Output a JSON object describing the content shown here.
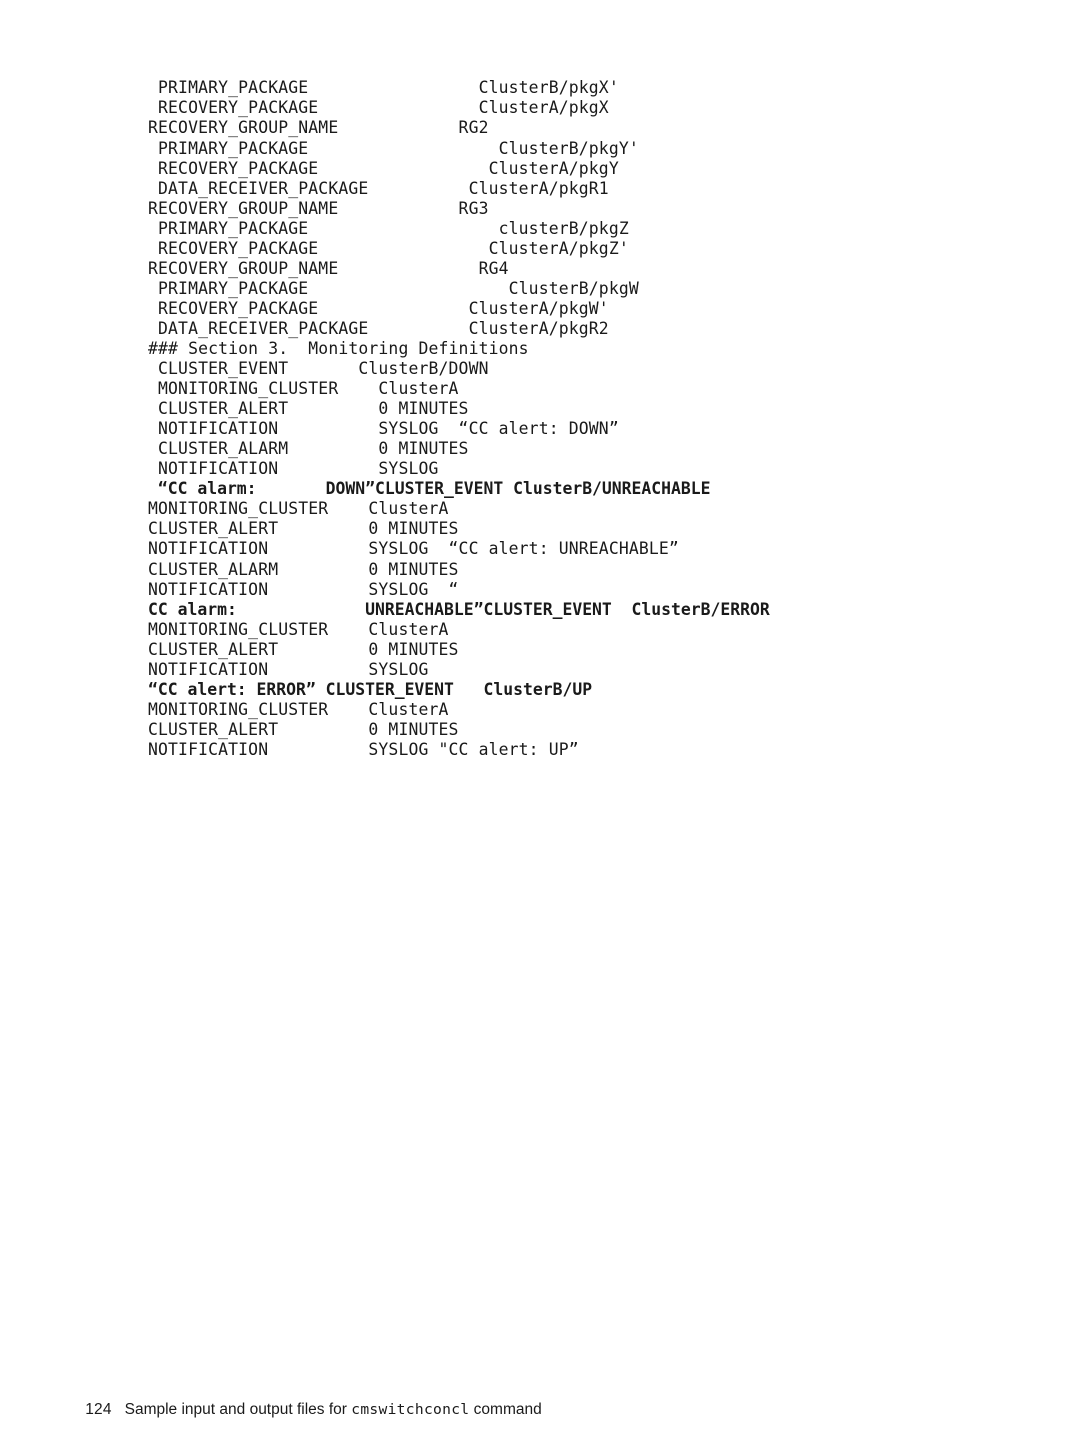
{
  "document": {
    "page_number": "124",
    "footer_caption_before": "Sample input and output files for ",
    "footer_command": "cmswitchconcl",
    "footer_caption_after": " command"
  },
  "code_listing": {
    "lines": [
      {
        "text": " PRIMARY_PACKAGE                 ClusterB/pkgX'",
        "emphasis": false
      },
      {
        "text": " RECOVERY_PACKAGE                ClusterA/pkgX",
        "emphasis": false
      },
      {
        "text": "RECOVERY_GROUP_NAME            RG2",
        "emphasis": false
      },
      {
        "text": " PRIMARY_PACKAGE                   ClusterB/pkgY'",
        "emphasis": false
      },
      {
        "text": " RECOVERY_PACKAGE                 ClusterA/pkgY",
        "emphasis": false
      },
      {
        "text": " DATA_RECEIVER_PACKAGE          ClusterA/pkgR1",
        "emphasis": false
      },
      {
        "text": "RECOVERY_GROUP_NAME            RG3",
        "emphasis": false
      },
      {
        "text": " PRIMARY_PACKAGE                   clusterB/pkgZ",
        "emphasis": false
      },
      {
        "text": " RECOVERY_PACKAGE                 ClusterA/pkgZ'",
        "emphasis": false
      },
      {
        "text": "RECOVERY_GROUP_NAME              RG4",
        "emphasis": false
      },
      {
        "text": " PRIMARY_PACKAGE                    ClusterB/pkgW",
        "emphasis": false
      },
      {
        "text": " RECOVERY_PACKAGE               ClusterA/pkgW'",
        "emphasis": false
      },
      {
        "text": " DATA_RECEIVER_PACKAGE          ClusterA/pkgR2",
        "emphasis": false
      },
      {
        "text": "### Section 3.  Monitoring Definitions",
        "emphasis": false
      },
      {
        "text": " CLUSTER_EVENT       ClusterB/DOWN",
        "emphasis": false
      },
      {
        "text": " MONITORING_CLUSTER    ClusterA",
        "emphasis": false
      },
      {
        "text": " CLUSTER_ALERT         0 MINUTES",
        "emphasis": false
      },
      {
        "text": " NOTIFICATION          SYSLOG  “CC alert: DOWN”",
        "emphasis": false
      },
      {
        "text": " CLUSTER_ALARM         0 MINUTES",
        "emphasis": false
      },
      {
        "text": " NOTIFICATION          SYSLOG",
        "emphasis": false
      },
      {
        "text": " “CC alarm:       DOWN”CLUSTER_EVENT ClusterB/UNREACHABLE",
        "emphasis": true
      },
      {
        "text": "MONITORING_CLUSTER    ClusterA",
        "emphasis": false
      },
      {
        "text": "CLUSTER_ALERT         0 MINUTES",
        "emphasis": false
      },
      {
        "text": "NOTIFICATION          SYSLOG  “CC alert: UNREACHABLE”",
        "emphasis": false
      },
      {
        "text": "CLUSTER_ALARM         0 MINUTES",
        "emphasis": false
      },
      {
        "text": "NOTIFICATION          SYSLOG  “",
        "emphasis": false
      },
      {
        "text": "CC alarm:             UNREACHABLE”CLUSTER_EVENT  ClusterB/ERROR",
        "emphasis": true
      },
      {
        "text": "MONITORING_CLUSTER    ClusterA",
        "emphasis": false
      },
      {
        "text": "CLUSTER_ALERT         0 MINUTES",
        "emphasis": false
      },
      {
        "text": "NOTIFICATION          SYSLOG",
        "emphasis": false
      },
      {
        "text": "“CC alert: ERROR” CLUSTER_EVENT   ClusterB/UP",
        "emphasis": true
      },
      {
        "text": "MONITORING_CLUSTER    ClusterA",
        "emphasis": false
      },
      {
        "text": "CLUSTER_ALERT         0 MINUTES",
        "emphasis": false
      },
      {
        "text": "NOTIFICATION          SYSLOG \"CC alert: UP”",
        "emphasis": false
      }
    ]
  }
}
